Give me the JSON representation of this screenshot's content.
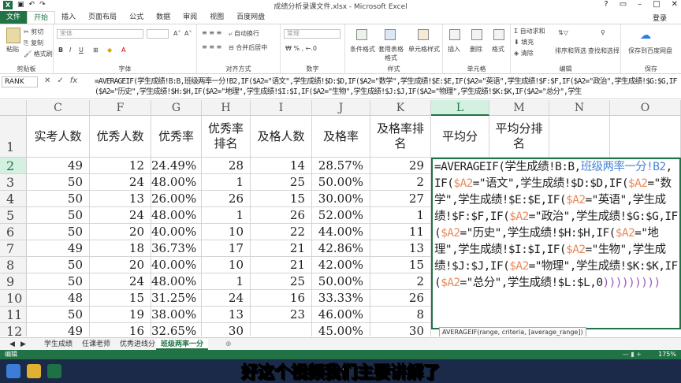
{
  "window": {
    "title": "成绩分析录课文件.xlsx - Microsoft Excel",
    "app_icon": "X"
  },
  "tabs": [
    "文件",
    "开始",
    "插入",
    "页面布局",
    "公式",
    "数据",
    "审阅",
    "视图",
    "百度网盘"
  ],
  "login": "登录",
  "ribbon": {
    "clipboard": {
      "label": "剪贴板",
      "paste": "粘贴",
      "cut": "剪切",
      "copy": "复制",
      "format_painter": "格式刷"
    },
    "font": {
      "label": "字体",
      "font_name": "宋体",
      "bold": "B",
      "italic": "I",
      "underline": "U",
      "font_size_up": "A",
      "font_size_down": "A"
    },
    "alignment": {
      "label": "对齐方式",
      "wrap": "自动换行",
      "merge": "合并后居中"
    },
    "number": {
      "label": "数字",
      "format": "常规"
    },
    "styles": {
      "label": "样式",
      "conditional": "条件格式",
      "table": "套用表格格式",
      "cell_styles": "单元格样式"
    },
    "cells": {
      "label": "单元格",
      "insert": "插入",
      "delete": "删除",
      "format": "格式"
    },
    "editing": {
      "label": "编辑",
      "autosum": "自动求和",
      "fill": "填充",
      "clear": "清除",
      "sort": "排序和筛选",
      "find": "查找和选择"
    },
    "save": {
      "label": "保存",
      "save_to": "保存到百度网盘"
    }
  },
  "name_box": "RANK",
  "formula_buttons": [
    "✕",
    "✓",
    "fx"
  ],
  "formula": "=AVERAGEIF(学生成绩!B:B,班级两率一分!B2,IF($A2=\"语文\",学生成绩!$D:$D,IF($A2=\"数学\",学生成绩!$E:$E,IF($A2=\"英语\",学生成绩!$F:$F,IF($A2=\"政治\",学生成绩!$G:$G,IF($A2=\"历史\",学生成绩!$H:$H,IF($A2=\"地理\",学生成绩!$I:$I,IF($A2=\"生物\",学生成绩!$J:$J,IF($A2=\"物理\",学生成绩!$K:$K,IF($A2=\"总分\",学生",
  "columns": [
    "C",
    "F",
    "G",
    "H",
    "I",
    "J",
    "K",
    "L",
    "M",
    "N",
    "O"
  ],
  "rows": [
    "1",
    "2",
    "3",
    "4",
    "5",
    "6",
    "7",
    "8",
    "9",
    "10",
    "11",
    "12"
  ],
  "headers": [
    "实考人数",
    "优秀人数",
    "优秀率",
    "优秀率排名",
    "及格人数",
    "及格率",
    "及格率排名",
    "平均分",
    "平均分排名"
  ],
  "data": [
    [
      "49",
      "12",
      "24.49%",
      "28",
      "14",
      "28.57%",
      "29"
    ],
    [
      "50",
      "24",
      "48.00%",
      "1",
      "25",
      "50.00%",
      "2"
    ],
    [
      "50",
      "13",
      "26.00%",
      "26",
      "15",
      "30.00%",
      "27"
    ],
    [
      "50",
      "24",
      "48.00%",
      "1",
      "26",
      "52.00%",
      "1"
    ],
    [
      "50",
      "20",
      "40.00%",
      "10",
      "22",
      "44.00%",
      "11"
    ],
    [
      "49",
      "18",
      "36.73%",
      "17",
      "21",
      "42.86%",
      "13"
    ],
    [
      "50",
      "20",
      "40.00%",
      "10",
      "21",
      "42.00%",
      "15"
    ],
    [
      "50",
      "24",
      "48.00%",
      "1",
      "25",
      "50.00%",
      "2"
    ],
    [
      "48",
      "15",
      "31.25%",
      "24",
      "16",
      "33.33%",
      "26"
    ],
    [
      "50",
      "19",
      "38.00%",
      "13",
      "23",
      "46.00%",
      "8"
    ],
    [
      "49",
      "16",
      "32.65%",
      "30",
      "",
      "45.00%",
      "30"
    ]
  ],
  "editor_parts": [
    [
      "t",
      "=AVERAGEIF(学生成绩!B:B,"
    ],
    [
      "b",
      "班级两率一分!B2"
    ],
    [
      "t",
      ",IF("
    ],
    [
      "r",
      "$A2"
    ],
    [
      "t",
      "=\"语文\",学生成绩!$D:$D,IF("
    ],
    [
      "r",
      "$A2"
    ],
    [
      "t",
      "=\"数学\",学生成绩!$E:$E,IF("
    ],
    [
      "r",
      "$A2"
    ],
    [
      "t",
      "=\"英语\",学生成绩!$F:$F,IF("
    ],
    [
      "r",
      "$A2"
    ],
    [
      "t",
      "=\"政治\",学生成绩!$G:$G,IF("
    ],
    [
      "r",
      "$A2"
    ],
    [
      "t",
      "=\"历史\",学生成绩!$H:$H,IF("
    ],
    [
      "r",
      "$A2"
    ],
    [
      "t",
      "=\"地理\",学生成绩!$I:$I,IF("
    ],
    [
      "r",
      "$A2"
    ],
    [
      "t",
      "=\"生物\",学生成绩!$J:$J,IF("
    ],
    [
      "r",
      "$A2"
    ],
    [
      "t",
      "=\"物理\",学生成绩!$K:$K,IF("
    ],
    [
      "r",
      "$A2"
    ],
    [
      "t",
      "=\"总分\",学生成绩!$L:$L,0"
    ],
    [
      "p",
      ")))))))))"
    ]
  ],
  "tooltip": "AVERAGEIF(range, criteria, [average_range])",
  "sheets": [
    "学生成绩",
    "任课老师",
    "优秀进线分",
    "班级两率一分"
  ],
  "active_sheet": 3,
  "status": {
    "mode": "编辑",
    "zoom": "175%"
  },
  "subtitle": "好这个视频我们主要讲解了"
}
